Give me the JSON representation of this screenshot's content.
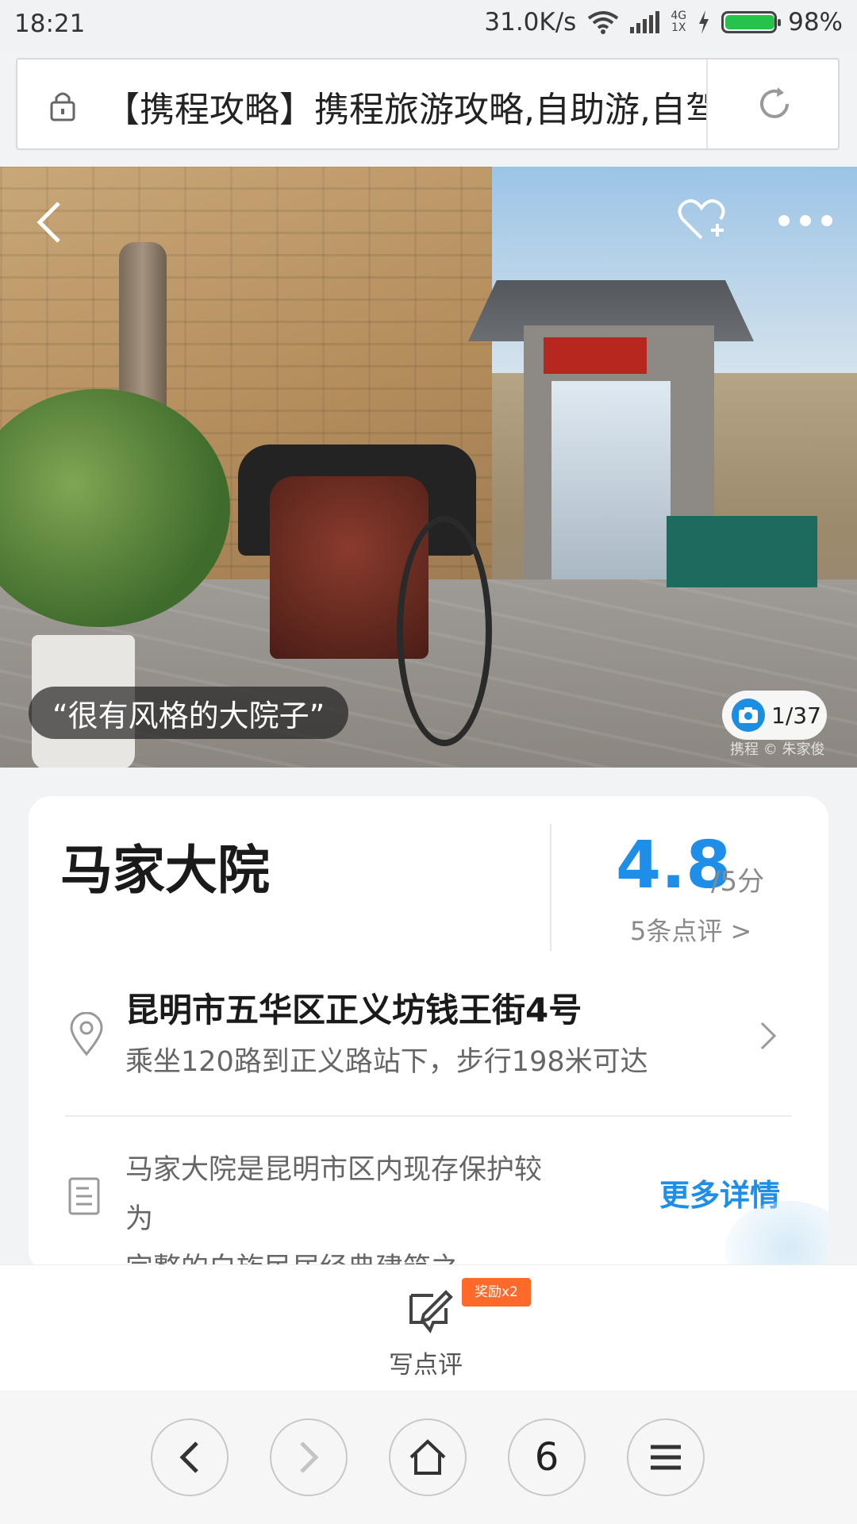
{
  "status_bar": {
    "time": "18:21",
    "speed": "31.0K/s",
    "network_top": "4G",
    "network_bottom": "1X",
    "battery": "98%"
  },
  "url_bar": {
    "title": "【携程攻略】携程旅游攻略,自助游,自驾"
  },
  "hero": {
    "quote": "“很有风格的大院子”",
    "photo_count": "1/37",
    "watermark": "携程 © 朱家俊"
  },
  "card": {
    "title": "马家大院",
    "score": "4.8",
    "score_unit": "/5分",
    "reviews": "5条点评 >",
    "address": "昆明市五华区正义坊钱王街4号",
    "route": "乘坐120路到正义路站下，步行198米可达",
    "desc_line1": "马家大院是昆明市区内现存保护较为",
    "desc_line2": "完整的白族民居经典建筑之一，曾...",
    "more": "更多详情"
  },
  "action_bar": {
    "reward": "奖励x2",
    "write": "写点评"
  },
  "nav": {
    "tabs_count": "6"
  },
  "colors": {
    "accent": "#1e8ee8",
    "reward": "#ff6a2b",
    "battery": "#27c24c"
  }
}
